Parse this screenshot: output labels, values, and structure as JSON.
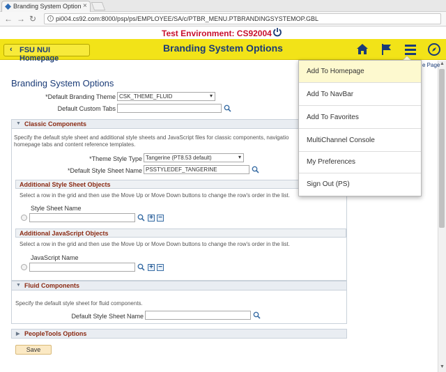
{
  "browser": {
    "tab_title": "Branding System Option",
    "tab_close": "×",
    "url": "pi004.cs92.com:8000/psp/ps/EMPLOYEE/SA/c/PTBR_MENU.PTBRANDINGSYSTEMOP.GBL"
  },
  "environment": {
    "banner": "Test Environment:  CS92004"
  },
  "header": {
    "home_button_label": "FSU NUI Homepage",
    "page_title": "Branding System Options"
  },
  "page": {
    "heading": "Branding System Options",
    "default_theme_label": "*Default Branding Theme",
    "default_theme_value": "CSK_THEME_FLUID",
    "default_tabs_label": "Default Custom Tabs",
    "default_tabs_value": "",
    "help_link": "e Page"
  },
  "classic": {
    "title": "Classic Components",
    "desc_line1": "Specify the default style sheet and additional style sheets and JavaScript files for classic components, navigatio",
    "desc_line2": "homepage tabs and content reference templates.",
    "theme_type_label": "*Theme Style Type",
    "theme_type_value": "Tangerine (PT8.53 default)",
    "style_sheet_label": "*Default Style Sheet Name",
    "style_sheet_value": "PSSTYLEDEF_TANGERINE"
  },
  "additional_ss": {
    "title": "Additional Style Sheet Objects",
    "desc": "Select a row in the grid and then use the Move Up or Move Down buttons to change the row's order in the list.",
    "column": "Style Sheet Name",
    "value": ""
  },
  "additional_js": {
    "title": "Additional JavaScript Objects",
    "desc": "Select a row in the grid and then use the Move Up or Move Down buttons to change the row's order in the list.",
    "column": "JavaScript Name",
    "value": ""
  },
  "fluid": {
    "title": "Fluid Components",
    "desc": "Specify the default style sheet for fluid components.",
    "style_sheet_label": "Default Style Sheet Name",
    "style_sheet_value": ""
  },
  "peopletools": {
    "title": "PeopleTools Options"
  },
  "buttons": {
    "save": "Save",
    "plus": "+",
    "minus": "−"
  },
  "menu": {
    "items": [
      "Add To Homepage",
      "Add To NavBar",
      "Add To Favorites",
      "MultiChannel Console",
      "My Preferences",
      "Sign Out (PS)"
    ],
    "highlighted_index": 0
  },
  "colors": {
    "header_yellow": "#f2e318",
    "title_blue": "#1a3b77",
    "env_red": "#c8102e",
    "section_text": "#8a2a13"
  }
}
